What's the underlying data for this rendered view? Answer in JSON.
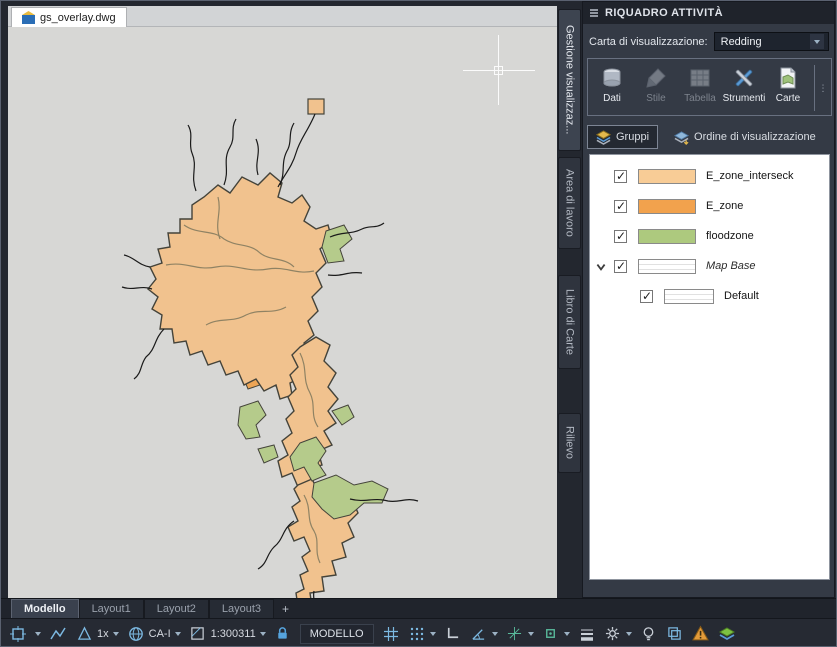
{
  "doc": {
    "tab_label": "gs_overlay.dwg"
  },
  "task_pane": {
    "title": "RIQUADRO ATTIVITÀ",
    "map_selector": {
      "label": "Carta di visualizzazione:",
      "value": "Redding"
    },
    "toolbar": {
      "items": [
        {
          "label": "Dati",
          "icon": "database-icon",
          "enabled": true
        },
        {
          "label": "Stile",
          "icon": "brush-icon",
          "enabled": false
        },
        {
          "label": "Tabella",
          "icon": "table-icon",
          "enabled": false
        },
        {
          "label": "Strumenti",
          "icon": "tools-icon",
          "enabled": true
        },
        {
          "label": "Carte",
          "icon": "map-sheet-icon",
          "enabled": true
        }
      ]
    },
    "view_tabs": [
      {
        "label": "Gruppi",
        "active": true
      },
      {
        "label": "Ordine di visualizzazione",
        "active": false
      }
    ],
    "layer_list": [
      {
        "name": "E_zone_interseck",
        "checked": true,
        "swatch_color": "#f8cc96",
        "indent": 0,
        "italic": false,
        "expander": false
      },
      {
        "name": "E_zone",
        "checked": true,
        "swatch_color": "#f2a24d",
        "indent": 0,
        "italic": false,
        "expander": false
      },
      {
        "name": "floodzone",
        "checked": true,
        "swatch_color": "#adc97e",
        "indent": 0,
        "italic": false,
        "expander": false
      },
      {
        "name": "Map Base",
        "checked": true,
        "swatch_color": "#ffffff",
        "indent": 0,
        "italic": true,
        "expander": true
      },
      {
        "name": "Default",
        "checked": true,
        "swatch_color": "#ffffff",
        "indent": 1,
        "italic": false,
        "expander": false
      }
    ]
  },
  "side_tabs": [
    {
      "label": "Gestione visualizzaz...",
      "active": true
    },
    {
      "label": "Area di lavoro",
      "active": false
    },
    {
      "label": "Libro di Carte",
      "active": false
    },
    {
      "label": "Rilievo",
      "active": false
    }
  ],
  "layout_tabs": {
    "tabs": [
      {
        "label": "Modello",
        "active": true
      },
      {
        "label": "Layout1",
        "active": false
      },
      {
        "label": "Layout2",
        "active": false
      },
      {
        "label": "Layout3",
        "active": false
      }
    ],
    "add_label": "+"
  },
  "status_bar": {
    "annotation_scale": "1x",
    "coordinate_system": "CA-I",
    "drawing_scale": "1:300311",
    "space_label": "MODELLO"
  },
  "map_view": {
    "colors": {
      "canvas": "#d7d7d5",
      "e_zone_interseck": "#f1c28e",
      "e_zone": "#eda556",
      "floodzone": "#b5cb8b",
      "stream_outline": "#1a1a1a",
      "accent_blue": "#7cb9e2",
      "warning_orange": "#e39b3a"
    }
  }
}
